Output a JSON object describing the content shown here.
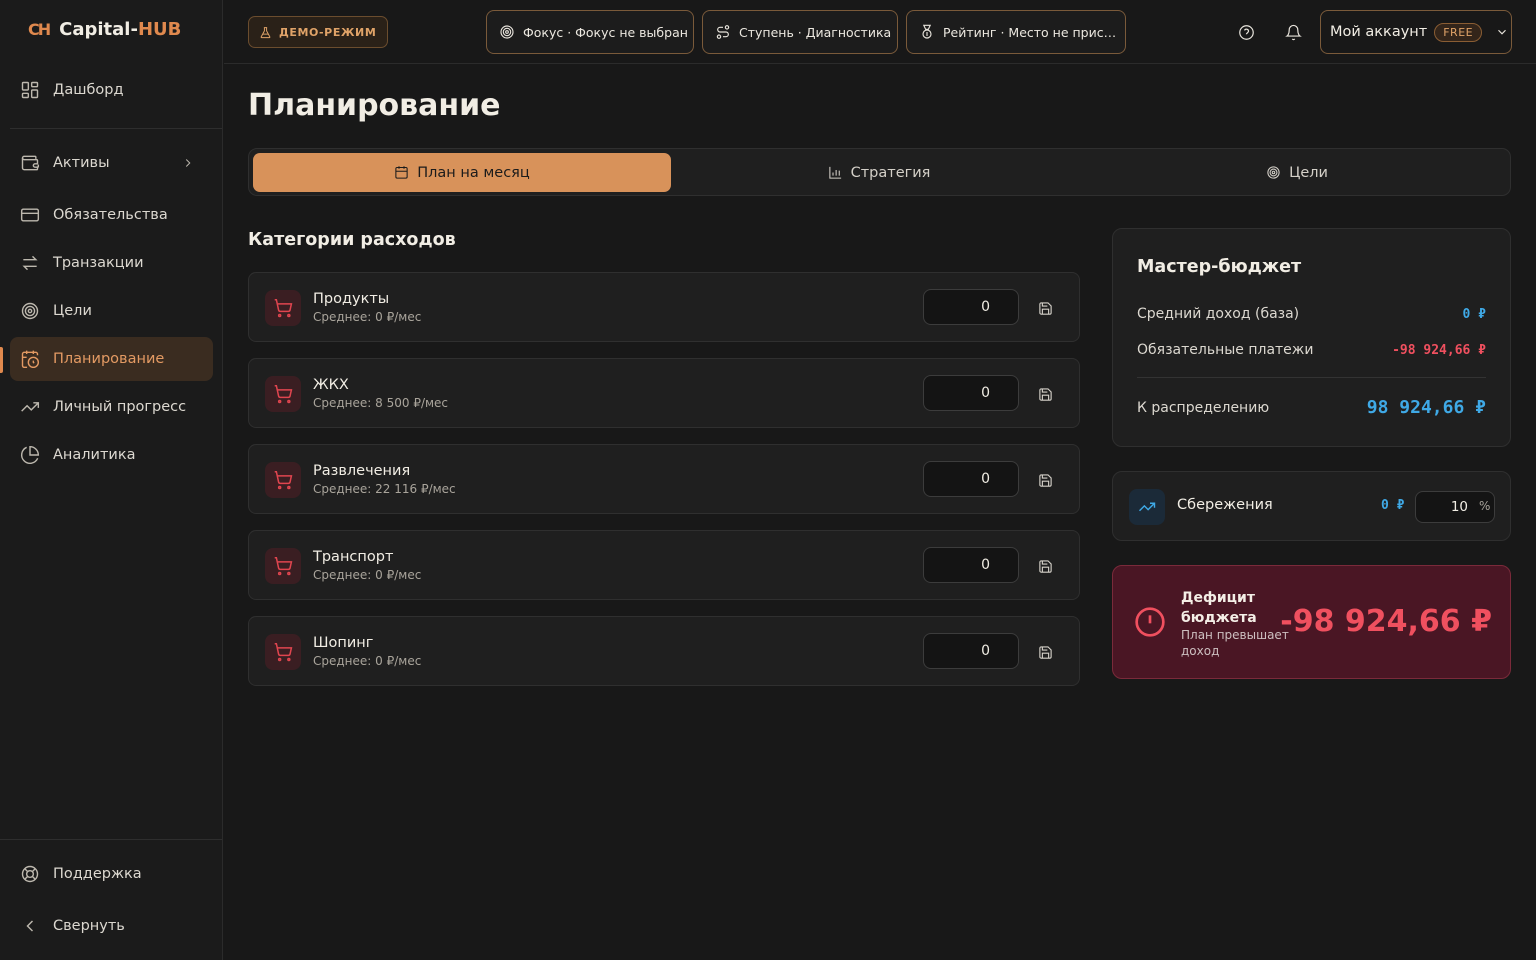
{
  "brand": {
    "mark": "CH",
    "name_prefix": "Capital-",
    "name_suffix": "HUB"
  },
  "sidebar": {
    "items": [
      {
        "label": "Дашборд",
        "icon": "grid-icon"
      },
      {
        "label": "Активы",
        "icon": "wallet-icon"
      },
      {
        "label": "Обязательства",
        "icon": "card-icon"
      },
      {
        "label": "Транзакции",
        "icon": "transfer-icon"
      },
      {
        "label": "Цели",
        "icon": "target-icon"
      },
      {
        "label": "Планирование",
        "icon": "calendar-clock-icon",
        "active": true
      },
      {
        "label": "Личный прогресс",
        "icon": "trend-icon"
      },
      {
        "label": "Аналитика",
        "icon": "pie-chart-icon"
      }
    ],
    "support": "Поддержка",
    "collapse": "Свернуть"
  },
  "topbar": {
    "demo": "ДЕМО-РЕЖИМ",
    "focus": "Фокус · Фокус не выбран",
    "stage": "Ступень · Диагностика",
    "rating": "Рейтинг · Место не прис…",
    "account": "Мой аккаунт",
    "plan_badge": "FREE"
  },
  "page": {
    "title": "Планирование",
    "tabs": [
      "План на месяц",
      "Стратегия",
      "Цели"
    ]
  },
  "categories": {
    "title": "Категории расходов",
    "items": [
      {
        "name": "Продукты",
        "avg": "Среднее: 0 ₽/мес",
        "value": "0"
      },
      {
        "name": "ЖКХ",
        "avg": "Среднее: 8 500 ₽/мес",
        "value": "0"
      },
      {
        "name": "Развлечения",
        "avg": "Среднее: 22 116 ₽/мес",
        "value": "0"
      },
      {
        "name": "Транспорт",
        "avg": "Среднее: 0 ₽/мес",
        "value": "0"
      },
      {
        "name": "Шопинг",
        "avg": "Среднее: 0 ₽/мес",
        "value": "0"
      }
    ]
  },
  "budget": {
    "title": "Мастер-бюджет",
    "income_label": "Средний доход (база)",
    "income_value": "0 ₽",
    "mandatory_label": "Обязательные платежи",
    "mandatory_value": "-98 924,66 ₽",
    "distribute_label": "К распределению",
    "distribute_value": "98 924,66 ₽"
  },
  "savings": {
    "label": "Сбережения",
    "value": "0 ₽",
    "percent": "10",
    "percent_sign": "%"
  },
  "deficit": {
    "title": "Дефицит бюджета",
    "subtitle": "План превышает доход",
    "amount": "-98 924,66 ₽"
  },
  "colors": {
    "accent": "#e0894e",
    "blue": "#3fa9e6",
    "red": "#f0505f",
    "deficit_bg": "#4a1624"
  }
}
